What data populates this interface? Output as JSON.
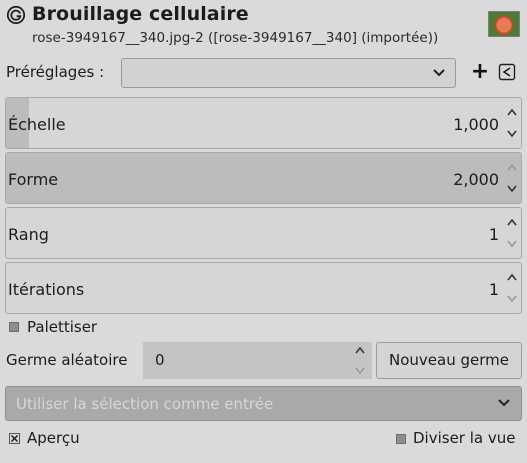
{
  "header": {
    "title": "Brouillage cellulaire",
    "subtitle": "rose-3949167__340.jpg-2 ([rose-3949167__340] (importée))"
  },
  "presets": {
    "label": "Préréglages :",
    "selected": ""
  },
  "params": [
    {
      "label": "Échelle",
      "value": "1,000",
      "level": 0.045
    },
    {
      "label": "Forme",
      "value": "2,000",
      "level": 1.0
    },
    {
      "label": "Rang",
      "value": "1",
      "level": 0.0
    },
    {
      "label": "Itérations",
      "value": "1",
      "level": 0.0
    }
  ],
  "palettize": {
    "label": "Palettiser",
    "checked": false
  },
  "seed": {
    "label": "Germe aléatoire",
    "value": "0",
    "new_seed_label": "Nouveau germe"
  },
  "selection_combo": {
    "text": "Utiliser la sélection comme entrée"
  },
  "preview": {
    "label": "Aperçu",
    "checked": true
  },
  "split_view": {
    "label": "Diviser la vue",
    "checked": false
  }
}
